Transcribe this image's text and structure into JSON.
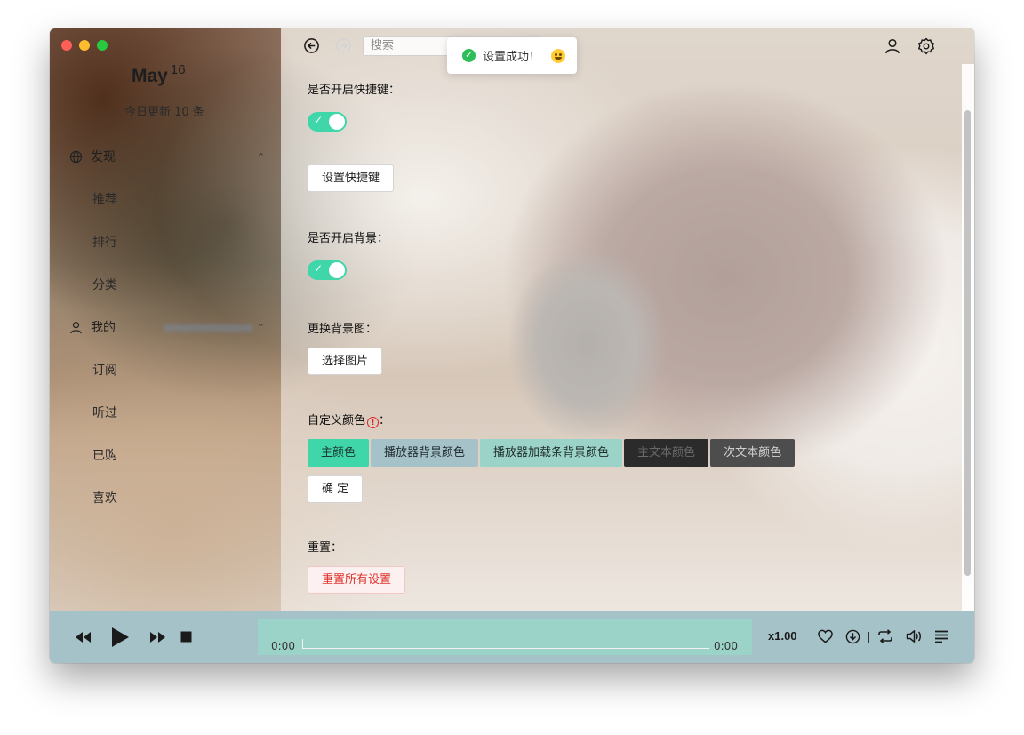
{
  "sidebar": {
    "date_month": "May",
    "date_day": "16",
    "today_updates": "今日更新 10 条",
    "discover": {
      "label": "发现",
      "items": [
        "推荐",
        "排行",
        "分类"
      ]
    },
    "mine": {
      "label": "我的",
      "items": [
        "订阅",
        "听过",
        "已购",
        "喜欢"
      ]
    }
  },
  "header": {
    "search_placeholder": "搜索",
    "toast_message": "设置成功！"
  },
  "settings": {
    "shortcut_label": "是否开启快捷键：",
    "shortcut_enabled": true,
    "set_shortcut_button": "设置快捷键",
    "background_label": "是否开启背景：",
    "background_enabled": true,
    "change_bg_label": "更换背景图：",
    "choose_image_button": "选择图片",
    "custom_color_label": "自定义颜色",
    "custom_color_suffix": "：",
    "color_buttons": [
      {
        "label": "主颜色",
        "bg": "#3fd6a9",
        "fg": "#1e3b33"
      },
      {
        "label": "播放器背景颜色",
        "bg": "#a6c2c9",
        "fg": "#1e2a2e"
      },
      {
        "label": "播放器加载条背景颜色",
        "bg": "#9cd3c9",
        "fg": "#1e2e2a"
      },
      {
        "label": "主文本颜色",
        "bg": "#2b2b2b",
        "fg": "#6a6a6a"
      },
      {
        "label": "次文本颜色",
        "bg": "#4d4d4d",
        "fg": "#d0d0d0"
      }
    ],
    "confirm_button": "确 定",
    "reset_label": "重置：",
    "reset_all_button": "重置所有设置"
  },
  "player": {
    "current_time": "0:00",
    "total_time": "0:00",
    "rate": "x1.00",
    "progress": 0
  },
  "colors": {
    "primary": "#3fd6a9",
    "player_bg": "#a6c2c9",
    "loading_bar": "#9cd3c9",
    "danger": "#e0312a"
  }
}
